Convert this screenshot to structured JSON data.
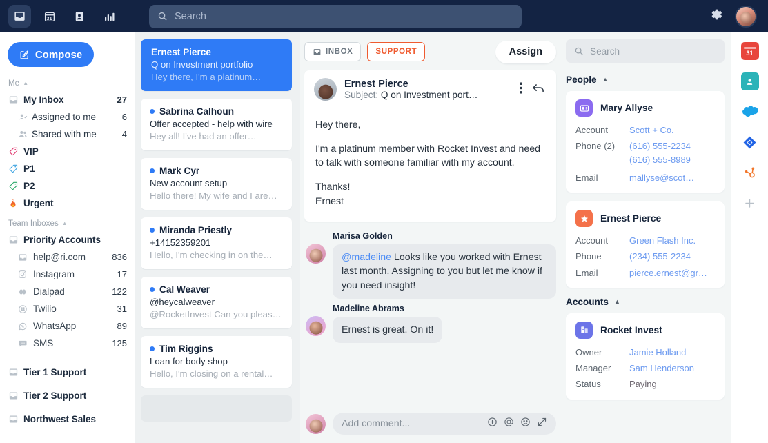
{
  "topbar": {
    "icons": [
      {
        "name": "inbox-icon",
        "active": true
      },
      {
        "name": "calendar-icon",
        "label": "31",
        "active": false
      },
      {
        "name": "contacts-icon",
        "active": false
      },
      {
        "name": "analytics-icon",
        "active": false
      }
    ],
    "search_placeholder": "Search",
    "settings_label": "Settings",
    "bg_color": "#132343"
  },
  "sidebar": {
    "compose_label": "Compose",
    "me_header": "Me",
    "team_header": "Team Inboxes",
    "me_items": [
      {
        "label": "My Inbox",
        "count": "27",
        "icon": "inbox-icon",
        "bold": true,
        "sub": false
      },
      {
        "label": "Assigned to me",
        "count": "6",
        "icon": "person-check-icon",
        "bold": false,
        "sub": true
      },
      {
        "label": "Shared with me",
        "count": "4",
        "icon": "people-icon",
        "bold": false,
        "sub": true
      }
    ],
    "tags": [
      {
        "label": "VIP",
        "icon": "tag-icon",
        "color": "#e0386f"
      },
      {
        "label": "P1",
        "icon": "tag-icon",
        "color": "#3da3e0"
      },
      {
        "label": "P2",
        "icon": "tag-icon",
        "color": "#2aa96a"
      },
      {
        "label": "Urgent",
        "icon": "fire-icon",
        "color": "#f0642a"
      }
    ],
    "team_group": {
      "label": "Priority Accounts",
      "icon": "inbox-icon"
    },
    "channels": [
      {
        "label": "help@ri.com",
        "count": "836",
        "icon": "email-icon"
      },
      {
        "label": "Instagram",
        "count": "17",
        "icon": "instagram-icon"
      },
      {
        "label": "Dialpad",
        "count": "122",
        "icon": "dialpad-icon"
      },
      {
        "label": "Twilio",
        "count": "31",
        "icon": "twilio-icon"
      },
      {
        "label": "WhatsApp",
        "count": "89",
        "icon": "whatsapp-icon"
      },
      {
        "label": "SMS",
        "count": "125",
        "icon": "sms-icon"
      }
    ],
    "other_inboxes": [
      {
        "label": "Tier 1 Support",
        "icon": "inbox-icon"
      },
      {
        "label": "Tier 2 Support",
        "icon": "inbox-icon"
      },
      {
        "label": "Northwest Sales",
        "icon": "inbox-icon"
      }
    ]
  },
  "conversations": [
    {
      "name": "Ernest Pierce",
      "subject": "Q on Investment portfolio",
      "preview": "Hey there, I'm a platinum…",
      "selected": true,
      "unread": false
    },
    {
      "name": "Sabrina Calhoun",
      "subject": "Offer accepted - help with wire",
      "preview": "Hey all! I've had an offer…",
      "selected": false,
      "unread": true
    },
    {
      "name": "Mark Cyr",
      "subject": "New account setup",
      "preview": "Hello there! My wife and I are…",
      "selected": false,
      "unread": true
    },
    {
      "name": "Miranda Priestly",
      "subject": "+14152359201",
      "preview": "Hello, I'm checking in on the…",
      "selected": false,
      "unread": true
    },
    {
      "name": "Cal Weaver",
      "subject": "@heycalweaver",
      "preview": "@RocketInvest Can you pleas…",
      "selected": false,
      "unread": true
    },
    {
      "name": "Tim Riggins",
      "subject": "Loan for body shop",
      "preview": "Hello, I'm closing on a rental…",
      "selected": false,
      "unread": true
    }
  ],
  "thread": {
    "tabs": [
      {
        "label": "INBOX",
        "style": "neutral",
        "icon": "inbox-icon"
      },
      {
        "label": "SUPPORT",
        "style": "orange"
      }
    ],
    "assign_label": "Assign",
    "message": {
      "sender": "Ernest Pierce",
      "subject_prefix": "Subject:",
      "subject": "Q on Investment port…",
      "paragraphs": [
        "Hey there,",
        "I'm a platinum member with Rocket Invest and need to talk with someone familiar with my account.",
        "Thanks!"
      ],
      "signature": "Ernest",
      "more_icon": "kebab-menu-icon",
      "reply_icon": "reply-icon"
    },
    "comments": [
      {
        "author": "Marisa Golden",
        "mention": "@madeline",
        "text": " Looks like you worked with Ernest last month. Assigning to you but let me know if you need insight!"
      },
      {
        "author": "Madeline Abrams",
        "mention": "",
        "text": "Ernest is great. On it!"
      }
    ],
    "composer": {
      "placeholder": "Add comment...",
      "icons": [
        "add-attachment-icon",
        "mention-icon",
        "emoji-icon",
        "expand-icon"
      ]
    }
  },
  "details": {
    "search_placeholder": "Search",
    "people_header": "People",
    "accounts_header": "Accounts",
    "people": [
      {
        "name": "Mary Allyse",
        "icon": "contact-card-icon",
        "icon_color": "#8b6bf0",
        "fields": [
          {
            "key": "Account",
            "values": [
              "Scott + Co."
            ],
            "link": true
          },
          {
            "key": "Phone (2)",
            "values": [
              "(616) 555-2234",
              "(616) 555-8989"
            ],
            "link": true
          },
          {
            "key": "Email",
            "values": [
              "mallyse@scot…"
            ],
            "link": true
          }
        ]
      },
      {
        "name": "Ernest Pierce",
        "icon": "star-badge-icon",
        "icon_color": "#f4714a",
        "fields": [
          {
            "key": "Account",
            "values": [
              "Green Flash Inc."
            ],
            "link": true
          },
          {
            "key": "Phone",
            "values": [
              "(234) 555-2234"
            ],
            "link": true
          },
          {
            "key": "Email",
            "values": [
              "pierce.ernest@gr…"
            ],
            "link": true
          }
        ]
      }
    ],
    "accounts": [
      {
        "name": "Rocket Invest",
        "icon": "building-icon",
        "icon_color": "#6c74e8",
        "fields": [
          {
            "key": "Owner",
            "values": [
              "Jamie Holland"
            ],
            "link": true
          },
          {
            "key": "Manager",
            "values": [
              "Sam Henderson"
            ],
            "link": true
          },
          {
            "key": "Status",
            "values": [
              "Paying"
            ],
            "link": false
          }
        ]
      }
    ]
  },
  "rail": {
    "items": [
      {
        "name": "calendar-integration-icon",
        "label": "31",
        "color": "#e8453c"
      },
      {
        "name": "contacts-integration-icon",
        "label": "",
        "color": "#2bb3b8"
      },
      {
        "name": "salesforce-integration-icon",
        "label": "",
        "color": "#1aa3e8"
      },
      {
        "name": "jira-integration-icon",
        "label": "",
        "color": "#2264e5"
      },
      {
        "name": "hubspot-integration-icon",
        "label": "",
        "color": "#f2762a"
      },
      {
        "name": "add-integration-icon",
        "label": "+",
        "color": "#b9c1c9"
      }
    ]
  },
  "colors": {
    "accent_blue": "#2f7bf6",
    "navy": "#132343",
    "orange": "#ef5b30",
    "page_bg": "#eef1f2"
  }
}
